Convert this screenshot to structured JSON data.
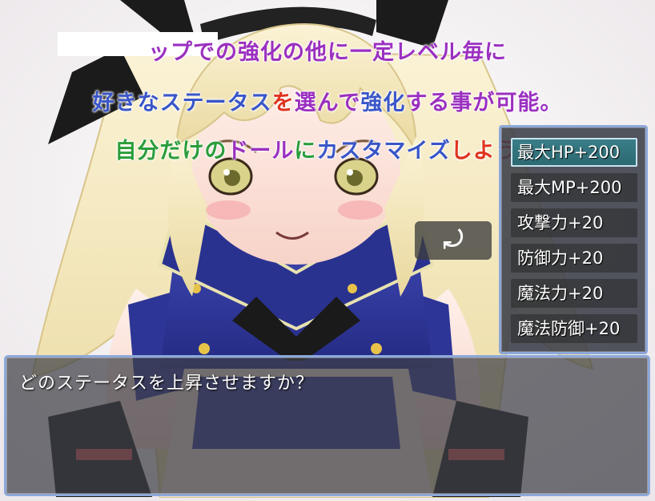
{
  "captions": [
    {
      "segments": [
        {
          "text": "ップでの強化の他に一定レベル毎に",
          "color": "#9b30c0"
        }
      ]
    },
    {
      "segments": [
        {
          "text": "好きなステータス",
          "color": "#3a56c8"
        },
        {
          "text": "を",
          "color": "#e0331e"
        },
        {
          "text": "選んで",
          "color": "#9b30c0"
        },
        {
          "text": "強化",
          "color": "#3a56c8"
        },
        {
          "text": "する事が可能。",
          "color": "#9b30c0"
        }
      ]
    },
    {
      "segments": [
        {
          "text": "自分だけの",
          "color": "#2a9d3a"
        },
        {
          "text": "ドール",
          "color": "#9b30c0"
        },
        {
          "text": "に",
          "color": "#2a9d3a"
        },
        {
          "text": "カスタマイズ",
          "color": "#3a56c8"
        },
        {
          "text": "しよう！",
          "color": "#e0331e"
        }
      ]
    }
  ],
  "back_button": {
    "icon": "undo-arrow-icon",
    "glyph": "⤾"
  },
  "choices": [
    {
      "label": "最大HP+200",
      "selected": true
    },
    {
      "label": "最大MP+200",
      "selected": false
    },
    {
      "label": "攻撃力+20",
      "selected": false
    },
    {
      "label": "防御力+20",
      "selected": false
    },
    {
      "label": "魔法力+20",
      "selected": false
    },
    {
      "label": "魔法防御+20",
      "selected": false
    }
  ],
  "message": {
    "text": "どのステータスを上昇させますか？"
  },
  "colors": {
    "window_border": "#8da8d9",
    "selected_choice": "#3a7f8a",
    "hair": "#f3e6b8",
    "uniform": "#2f3a9e"
  }
}
